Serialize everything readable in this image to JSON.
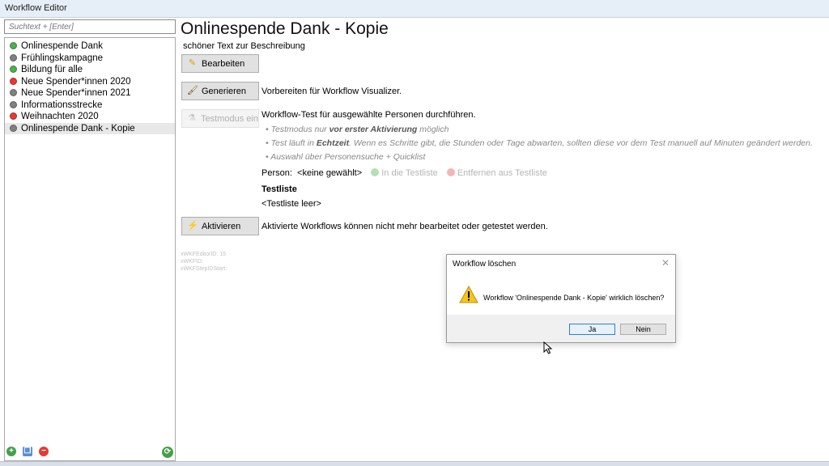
{
  "window": {
    "title": "Workflow Editor"
  },
  "sidebar": {
    "search_placeholder": "Suchtext + [Enter]",
    "items": [
      {
        "label": "Onlinespende Dank",
        "status_color": "#4caf50"
      },
      {
        "label": "Frühlingskampagne",
        "status_color": "#808080"
      },
      {
        "label": "Bildung für alle",
        "status_color": "#4caf50"
      },
      {
        "label": "Neue Spender*innen 2020",
        "status_color": "#e53935"
      },
      {
        "label": "Neue Spender*innen 2021",
        "status_color": "#808080"
      },
      {
        "label": "Informationsstrecke",
        "status_color": "#808080"
      },
      {
        "label": "Weihnachten 2020",
        "status_color": "#e53935"
      },
      {
        "label": "Onlinespende Dank - Kopie",
        "status_color": "#808080",
        "selected": true
      }
    ],
    "bottom_icons": [
      "add-icon",
      "copy-icon",
      "delete-icon",
      "refresh-icon"
    ]
  },
  "main": {
    "title": "Onlinespende Dank - Kopie",
    "description": "schöner Text zur Beschreibung",
    "edit_button": "Bearbeiten",
    "generate_button": "Generieren",
    "generate_text": "Vorbereiten für Workflow Visualizer.",
    "testmode_button": "Testmodus ein",
    "test_text": "Workflow-Test für ausgewählte Personen durchführen.",
    "bullets": [
      {
        "pre": "Testmodus nur ",
        "bold": "vor erster Aktivierung",
        "post": " möglich"
      },
      {
        "pre": "Test läuft in ",
        "bold": "Echtzeit",
        "post": ". Wenn es Schritte gibt, die Stunden oder Tage abwarten, sollten diese vor dem Test manuell auf Minuten geändert werden."
      },
      {
        "pre": "Auswahl über Personensuche + Quicklist",
        "bold": "",
        "post": ""
      }
    ],
    "person_label": "Person:",
    "person_value": "<keine gewählt>",
    "add_to_testlist": "In die Testliste",
    "remove_from_testlist": "Entfernen aus Testliste",
    "testlist_heading": "Testliste",
    "testlist_empty": "<Testliste leer>",
    "activate_button": "Aktivieren",
    "activate_text": "Aktivierte Workflows können nicht mehr bearbeitet oder getestet werden.",
    "meta": [
      "xWKFEditorID: 15",
      "xWKFID:",
      "xWKFStepIDStart:"
    ]
  },
  "dialog": {
    "title": "Workflow löschen",
    "message": "Workflow 'Onlinespende Dank - Kopie' wirklich löschen?",
    "yes": "Ja",
    "no": "Nein"
  },
  "colors": {
    "green": "#4caf50",
    "red": "#e53935",
    "grey": "#808080",
    "accent": "#2f7fd0"
  }
}
